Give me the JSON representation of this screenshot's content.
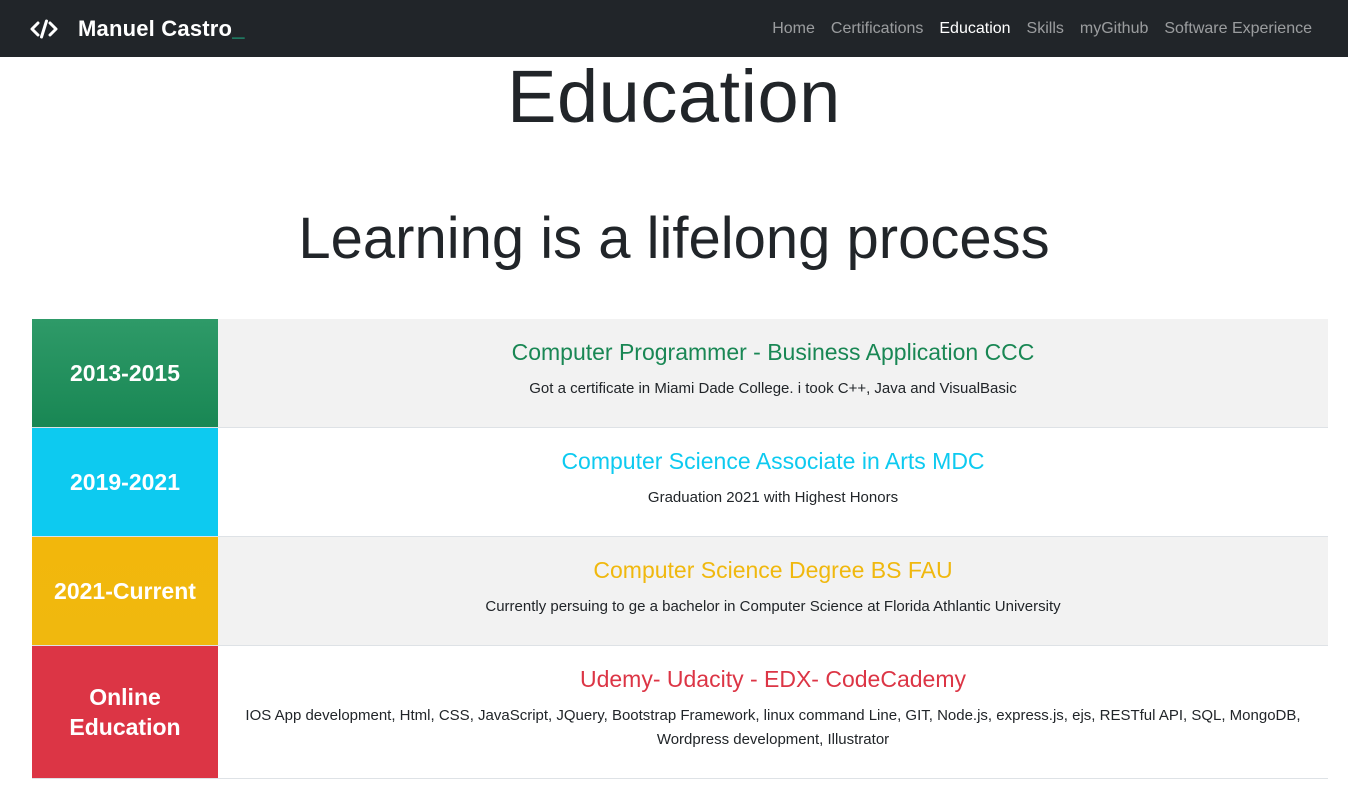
{
  "navbar": {
    "brand": "Manuel Castro",
    "brand_cursor": "_",
    "brand_icon": "code-icon",
    "links": [
      "Home",
      "Certifications",
      "Education",
      "Skills",
      "myGithub",
      "Software Experience"
    ],
    "active": "Education"
  },
  "page": {
    "title": "Education",
    "subtitle": "Learning is a lifelong process"
  },
  "education": [
    {
      "years": "2013-2015",
      "title": "Computer Programmer - Business Application CCC",
      "description": "Got a certificate in Miami Dade College. i took C++, Java and VisualBasic",
      "color": "#198754",
      "color_light": "#2e9a68"
    },
    {
      "years": "2019-2021",
      "title": "Computer Science Associate in Arts MDC",
      "description": "Graduation 2021 with Highest Honors",
      "color": "#0dcaf0",
      "color_light": "#0dcaf0"
    },
    {
      "years": "2021-Current",
      "title": "Computer Science Degree BS FAU",
      "description": "Currently persuing to ge a bachelor in Computer Science at Florida Athlantic University",
      "color": "#f0b80e",
      "color_light": "#f2b70c"
    },
    {
      "years": "Online Education",
      "title": "Udemy- Udacity - EDX- CodeCademy",
      "description": "IOS App development, Html, CSS, JavaScript, JQuery, Bootstrap Framework, linux command Line, GIT, Node.js, express.js, ejs, RESTful API, SQL, MongoDB, Wordpress development, Illustrator",
      "color": "#dc3545",
      "color_light": "#dc3545"
    }
  ]
}
